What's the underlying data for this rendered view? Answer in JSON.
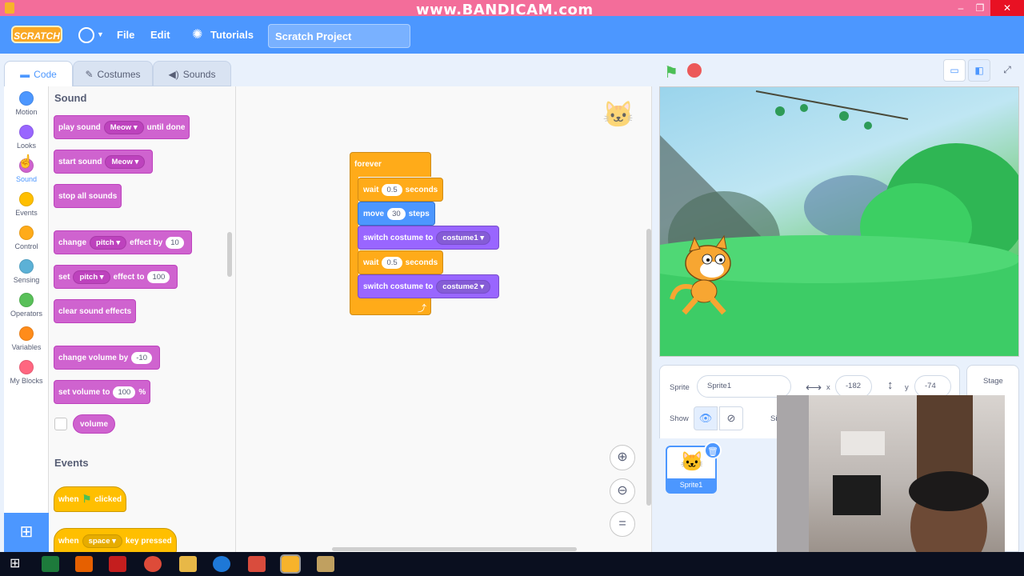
{
  "window": {
    "watermark": "www.BANDICAM.com",
    "controls": [
      "–",
      "❐",
      "✕"
    ]
  },
  "menubar": {
    "logo": "SCRATCH",
    "file": "File",
    "edit": "Edit",
    "tutorials": "Tutorials",
    "project_title": "Scratch Project"
  },
  "tabs": {
    "code": "Code",
    "costumes": "Costumes",
    "sounds": "Sounds"
  },
  "categories": [
    {
      "label": "Motion",
      "color": "#4c97ff"
    },
    {
      "label": "Looks",
      "color": "#9966ff"
    },
    {
      "label": "Sound",
      "color": "#cf63cf"
    },
    {
      "label": "Events",
      "color": "#ffbf00"
    },
    {
      "label": "Control",
      "color": "#ffab19"
    },
    {
      "label": "Sensing",
      "color": "#5cb1d6"
    },
    {
      "label": "Operators",
      "color": "#59c059"
    },
    {
      "label": "Variables",
      "color": "#ff8c1a"
    },
    {
      "label": "My Blocks",
      "color": "#ff6680"
    }
  ],
  "palette": {
    "sound_title": "Sound",
    "play_sound": {
      "pre": "play sound",
      "drop": "Meow",
      "post": "until done"
    },
    "start_sound": {
      "pre": "start sound",
      "drop": "Meow"
    },
    "stop_all": "stop all sounds",
    "change_effect": {
      "pre": "change",
      "drop": "pitch",
      "mid": "effect by",
      "num": "10"
    },
    "set_effect": {
      "pre": "set",
      "drop": "pitch",
      "mid": "effect to",
      "num": "100"
    },
    "clear_effects": "clear sound effects",
    "change_volume": {
      "pre": "change volume by",
      "num": "-10"
    },
    "set_volume": {
      "pre": "set volume to",
      "num": "100",
      "post": "%"
    },
    "volume": "volume",
    "events_title": "Events",
    "when_flag": {
      "pre": "when",
      "post": "clicked"
    },
    "when_key": {
      "pre": "when",
      "drop": "space",
      "post": "key pressed"
    }
  },
  "script": {
    "forever": "forever",
    "wait1": {
      "pre": "wait",
      "num": "0.5",
      "post": "seconds"
    },
    "move": {
      "pre": "move",
      "num": "30",
      "post": "steps"
    },
    "switch1": {
      "pre": "switch costume to",
      "drop": "costume1"
    },
    "wait2": {
      "pre": "wait",
      "num": "0.5",
      "post": "seconds"
    },
    "switch2": {
      "pre": "switch costume to",
      "drop": "costume2"
    }
  },
  "sprite_info": {
    "sprite_label": "Sprite",
    "sprite_name": "Sprite1",
    "x_label": "x",
    "x_value": "-182",
    "y_label": "y",
    "y_value": "-74",
    "show_label": "Show",
    "size_label_partial": "Si"
  },
  "sprite_list": [
    {
      "name": "Sprite1"
    }
  ],
  "stage_pane": {
    "label": "Stage"
  }
}
